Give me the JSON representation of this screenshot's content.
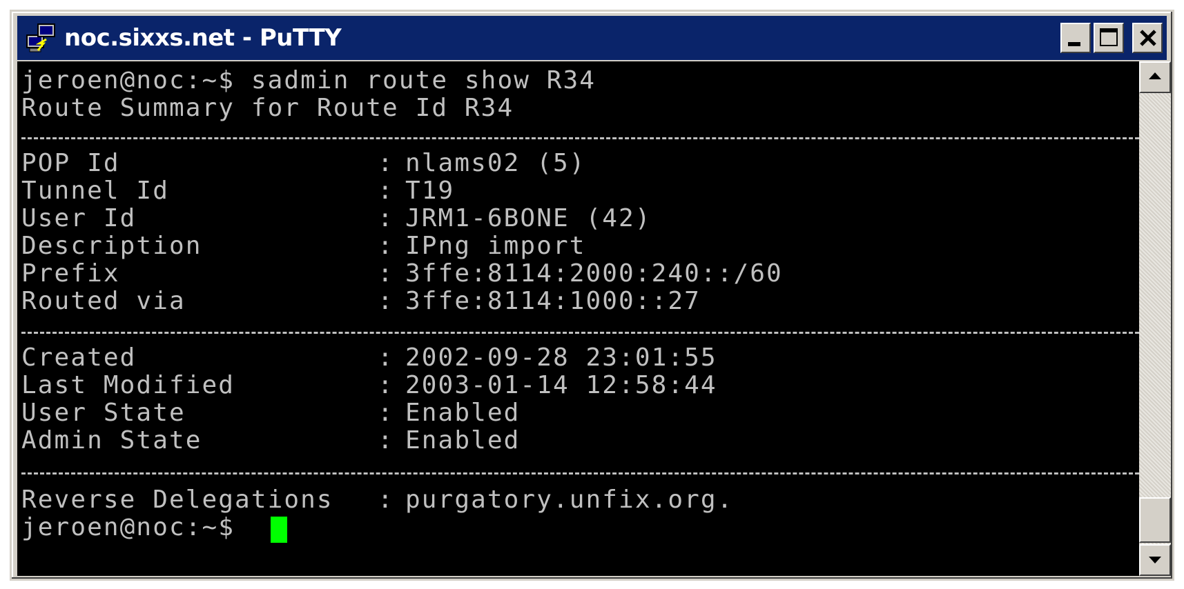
{
  "window": {
    "title": "noc.sixxs.net - PuTTY",
    "icon": "putty-app-icon",
    "buttons": {
      "minimize": "minimize-icon",
      "maximize": "maximize-icon",
      "close": "close-icon"
    }
  },
  "terminal": {
    "command_line": "jeroen@noc:~$ sadmin route show R34",
    "header_line": "Route Summary for Route Id R34",
    "rows": [
      {
        "label": "POP Id",
        "value": "nlams02 (5)"
      },
      {
        "label": "Tunnel Id",
        "value": "T19"
      },
      {
        "label": "User Id",
        "value": "JRM1-6BONE (42)"
      },
      {
        "label": "Description",
        "value": "IPng import"
      },
      {
        "label": "Prefix",
        "value": "3ffe:8114:2000:240::/60"
      },
      {
        "label": "Routed via",
        "value": "3ffe:8114:1000::27"
      },
      {
        "label": "Created",
        "value": "2002-09-28 23:01:55"
      },
      {
        "label": "Last Modified",
        "value": "2003-01-14 12:58:44"
      },
      {
        "label": "User State",
        "value": "Enabled"
      },
      {
        "label": "Admin State",
        "value": "Enabled"
      },
      {
        "label": "Reverse Delegations",
        "value": "purgatory.unfix.org."
      }
    ],
    "separator": ":",
    "prompt": "jeroen@noc:~$"
  },
  "colors": {
    "terminal_bg": "#000000",
    "terminal_fg": "#c0c0c0",
    "cursor": "#00ff00",
    "titlebar": "#0a246a"
  }
}
